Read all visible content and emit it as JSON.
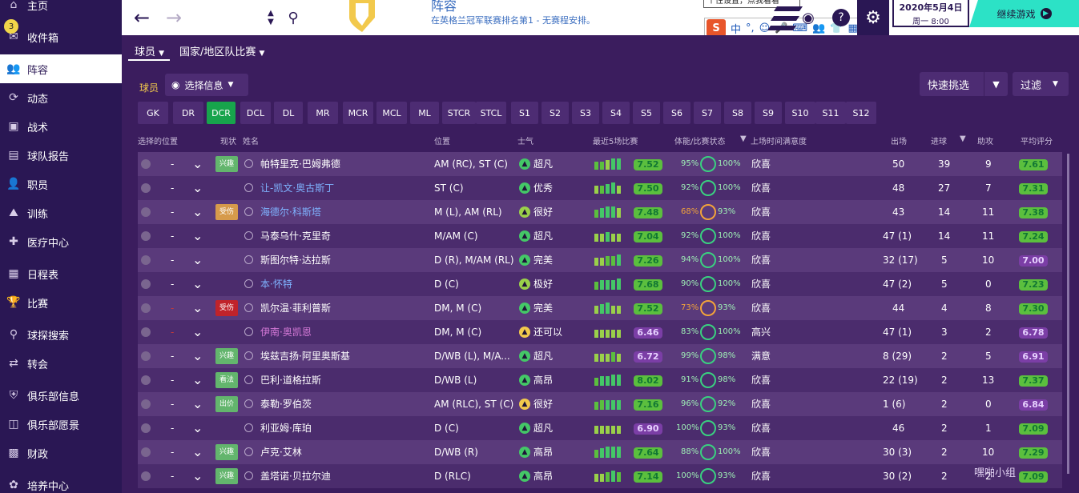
{
  "sidebar": {
    "items": [
      {
        "label": "主页",
        "icon": "home-icon"
      },
      {
        "label": "收件箱",
        "icon": "inbox-icon",
        "badge": "3"
      },
      {
        "label": "阵容",
        "icon": "squad-icon",
        "active": true
      },
      {
        "label": "动态",
        "icon": "dynamics-icon"
      },
      {
        "label": "战术",
        "icon": "tactics-icon"
      },
      {
        "label": "球队报告",
        "icon": "report-icon"
      },
      {
        "label": "职员",
        "icon": "staff-icon"
      },
      {
        "label": "训练",
        "icon": "training-icon"
      },
      {
        "label": "医疗中心",
        "icon": "medical-icon"
      },
      {
        "label": "日程表",
        "icon": "calendar-icon"
      },
      {
        "label": "比赛",
        "icon": "trophy-icon"
      },
      {
        "label": "球探搜索",
        "icon": "scout-search-icon"
      },
      {
        "label": "转会",
        "icon": "transfer-icon"
      },
      {
        "label": "俱乐部信息",
        "icon": "club-info-icon"
      },
      {
        "label": "俱乐部愿景",
        "icon": "club-vision-icon"
      },
      {
        "label": "财政",
        "icon": "finance-icon"
      },
      {
        "label": "培养中心",
        "icon": "development-icon"
      }
    ]
  },
  "header": {
    "title": "阵容",
    "subtitle": "在英格兰冠军联赛排名第1 - 无赛程安排。",
    "tooltip": "个性设置，点我看看",
    "ime": [
      "中",
      "°,",
      "☺",
      "🎤",
      "⌨",
      "👥",
      "👕",
      "▦"
    ],
    "date_main": "2020年5月4日",
    "date_sub": "周一 8:00",
    "continue_label": "继续游戏",
    "help_label": "?"
  },
  "tabs": {
    "players": "球员",
    "national": "国家/地区队比赛"
  },
  "filters": {
    "players_label": "球员",
    "select_info": "选择信息",
    "quick_pick": "快速挑选",
    "filter": "过滤"
  },
  "positions": [
    "GK",
    "DR",
    "DCR",
    "DCL",
    "DL",
    "MR",
    "MCR",
    "MCL",
    "ML",
    "STCR",
    "STCL",
    "S1",
    "S2",
    "S3",
    "S4",
    "S5",
    "S6",
    "S7",
    "S8",
    "S9",
    "S10",
    "S11",
    "S12"
  ],
  "active_position": "DCR",
  "columns": {
    "select_pos": "选择的位置",
    "status": "现状",
    "name": "姓名",
    "position": "位置",
    "morale": "士气",
    "form": "最近5场比赛",
    "condition": "体能/比赛状态",
    "satisfaction": "上场时间满意度",
    "apps": "出场",
    "goals": "进球",
    "assists": "助攻",
    "avg": "平均评分"
  },
  "colors": {
    "sidebar": "#2a1754",
    "accent": "#2ce2c6",
    "chip_active": "#17a44c",
    "rating_green": "#5bbf3e",
    "rating_purple": "#7b3ea6"
  },
  "players": [
    {
      "status": "兴趣",
      "status_class": "st-interest",
      "name": "帕特里克·巴姆弗德",
      "name_color": "#ffffff",
      "position": "AM (RC), ST (C)",
      "morale": "超凡",
      "morale_color": "#44c767",
      "form": "7.52",
      "form_class": "green",
      "cond": "95%",
      "ring": "green",
      "sharp": "100%",
      "sat": "欣喜",
      "apps": "50",
      "goals": "39",
      "assists": "9",
      "avg": "7.61",
      "avg_class": "green"
    },
    {
      "status": "",
      "status_class": "",
      "name": "让-凯文·奥古斯丁",
      "name_color": "#7fb3ff",
      "position": "ST (C)",
      "morale": "优秀",
      "morale_color": "#44c767",
      "form": "7.50",
      "form_class": "green",
      "cond": "92%",
      "ring": "green",
      "sharp": "100%",
      "sat": "欣喜",
      "apps": "48",
      "goals": "27",
      "assists": "7",
      "avg": "7.31",
      "avg_class": "green"
    },
    {
      "status": "受伤",
      "status_class": "st-injured",
      "name": "海德尔·科斯塔",
      "name_color": "#7fb3ff",
      "position": "M (L), AM (RL)",
      "morale": "很好",
      "morale_color": "#9ad04a",
      "form": "7.48",
      "form_class": "green",
      "cond": "68%",
      "cond_color": "#f2a33a",
      "ring": "orange",
      "sharp": "93%",
      "sat": "欣喜",
      "apps": "43",
      "goals": "14",
      "assists": "11",
      "avg": "7.38",
      "avg_class": "green"
    },
    {
      "status": "",
      "status_class": "",
      "name": "马泰乌什·克里奇",
      "name_color": "#ffffff",
      "position": "M/AM (C)",
      "morale": "超凡",
      "morale_color": "#44c767",
      "form": "7.04",
      "form_class": "green",
      "cond": "92%",
      "ring": "green",
      "sharp": "100%",
      "sat": "欣喜",
      "apps": "47 (1)",
      "goals": "14",
      "assists": "11",
      "avg": "7.24",
      "avg_class": "green"
    },
    {
      "status": "",
      "status_class": "",
      "name": "斯图尔特·达拉斯",
      "name_color": "#ffffff",
      "position": "D (R), M/AM (RL)",
      "morale": "完美",
      "morale_color": "#44c767",
      "form": "7.26",
      "form_class": "green",
      "cond": "94%",
      "ring": "green",
      "sharp": "100%",
      "sat": "欣喜",
      "apps": "32 (17)",
      "goals": "5",
      "assists": "10",
      "avg": "7.00",
      "avg_class": "purple"
    },
    {
      "status": "",
      "status_class": "",
      "name": "本·怀特",
      "name_color": "#7fb3ff",
      "position": "D (C)",
      "morale": "极好",
      "morale_color": "#9ad04a",
      "form": "7.68",
      "form_class": "green",
      "cond": "90%",
      "ring": "green",
      "sharp": "100%",
      "sat": "欣喜",
      "apps": "47 (2)",
      "goals": "5",
      "assists": "0",
      "avg": "7.23",
      "avg_class": "green"
    },
    {
      "status": "受伤",
      "status_class": "st-injured2",
      "name": "凯尔温·菲利普斯",
      "name_color": "#ffffff",
      "position": "DM, M (C)",
      "morale": "完美",
      "morale_color": "#44c767",
      "form": "7.52",
      "form_class": "green",
      "cond": "73%",
      "cond_color": "#f2a33a",
      "ring": "orange",
      "sharp": "93%",
      "sat": "欣喜",
      "apps": "44",
      "goals": "4",
      "assists": "8",
      "avg": "7.30",
      "avg_class": "green"
    },
    {
      "status": "",
      "status_class": "",
      "name": "伊南·奥凯恩",
      "name_color": "#d67ad8",
      "position": "DM, M (C)",
      "morale": "还可以",
      "morale_color": "#f2c94c",
      "form": "6.46",
      "form_class": "purple",
      "cond": "83%",
      "ring": "green",
      "sharp": "100%",
      "sat": "高兴",
      "apps": "47 (1)",
      "goals": "3",
      "assists": "2",
      "avg": "6.78",
      "avg_class": "purple"
    },
    {
      "status": "兴趣",
      "status_class": "st-interest",
      "name": "埃兹吉扬·阿里奥斯基",
      "name_color": "#ffffff",
      "position": "D/WB (L), M/A...",
      "morale": "超凡",
      "morale_color": "#44c767",
      "form": "6.72",
      "form_class": "purple",
      "cond": "99%",
      "ring": "green",
      "sharp": "98%",
      "sat": "满意",
      "apps": "8 (29)",
      "goals": "2",
      "assists": "5",
      "avg": "6.91",
      "avg_class": "purple"
    },
    {
      "status": "看法",
      "status_class": "st-watch",
      "name": "巴利·道格拉斯",
      "name_color": "#ffffff",
      "position": "D/WB (L)",
      "morale": "高昂",
      "morale_color": "#44c767",
      "form": "8.02",
      "form_class": "green",
      "cond": "91%",
      "ring": "green",
      "sharp": "98%",
      "sat": "欣喜",
      "apps": "22 (19)",
      "goals": "2",
      "assists": "13",
      "avg": "7.37",
      "avg_class": "green"
    },
    {
      "status": "出价",
      "status_class": "st-sell",
      "name": "泰勒·罗伯茨",
      "name_color": "#ffffff",
      "position": "AM (RLC), ST (C)",
      "morale": "很好",
      "morale_color": "#f2c94c",
      "form": "7.16",
      "form_class": "green",
      "cond": "96%",
      "ring": "green",
      "sharp": "92%",
      "sat": "欣喜",
      "apps": "1 (6)",
      "goals": "2",
      "assists": "0",
      "avg": "6.84",
      "avg_class": "purple"
    },
    {
      "status": "",
      "status_class": "",
      "name": "利亚姆·库珀",
      "name_color": "#ffffff",
      "position": "D (C)",
      "morale": "超凡",
      "morale_color": "#44c767",
      "form": "6.90",
      "form_class": "purple",
      "cond": "100%",
      "ring": "green",
      "sharp": "93%",
      "sat": "欣喜",
      "apps": "46",
      "goals": "2",
      "assists": "1",
      "avg": "7.09",
      "avg_class": "green"
    },
    {
      "status": "兴趣",
      "status_class": "st-interest",
      "name": "卢克·艾林",
      "name_color": "#ffffff",
      "position": "D/WB (R)",
      "morale": "高昂",
      "morale_color": "#44c767",
      "form": "7.64",
      "form_class": "green",
      "cond": "88%",
      "ring": "green",
      "sharp": "100%",
      "sat": "欣喜",
      "apps": "30 (3)",
      "goals": "2",
      "assists": "10",
      "avg": "7.29",
      "avg_class": "green"
    },
    {
      "status": "兴趣",
      "status_class": "st-interest",
      "name": "盖塔诺·贝拉尔迪",
      "name_color": "#ffffff",
      "position": "D (RLC)",
      "morale": "高昂",
      "morale_color": "#44c767",
      "form": "7.14",
      "form_class": "green",
      "cond": "100%",
      "ring": "green",
      "sharp": "93%",
      "sat": "欣喜",
      "apps": "30 (2)",
      "goals": "2",
      "assists": "2",
      "avg": "7.09",
      "avg_class": "green"
    }
  ],
  "watermark": "嘿啪小组"
}
